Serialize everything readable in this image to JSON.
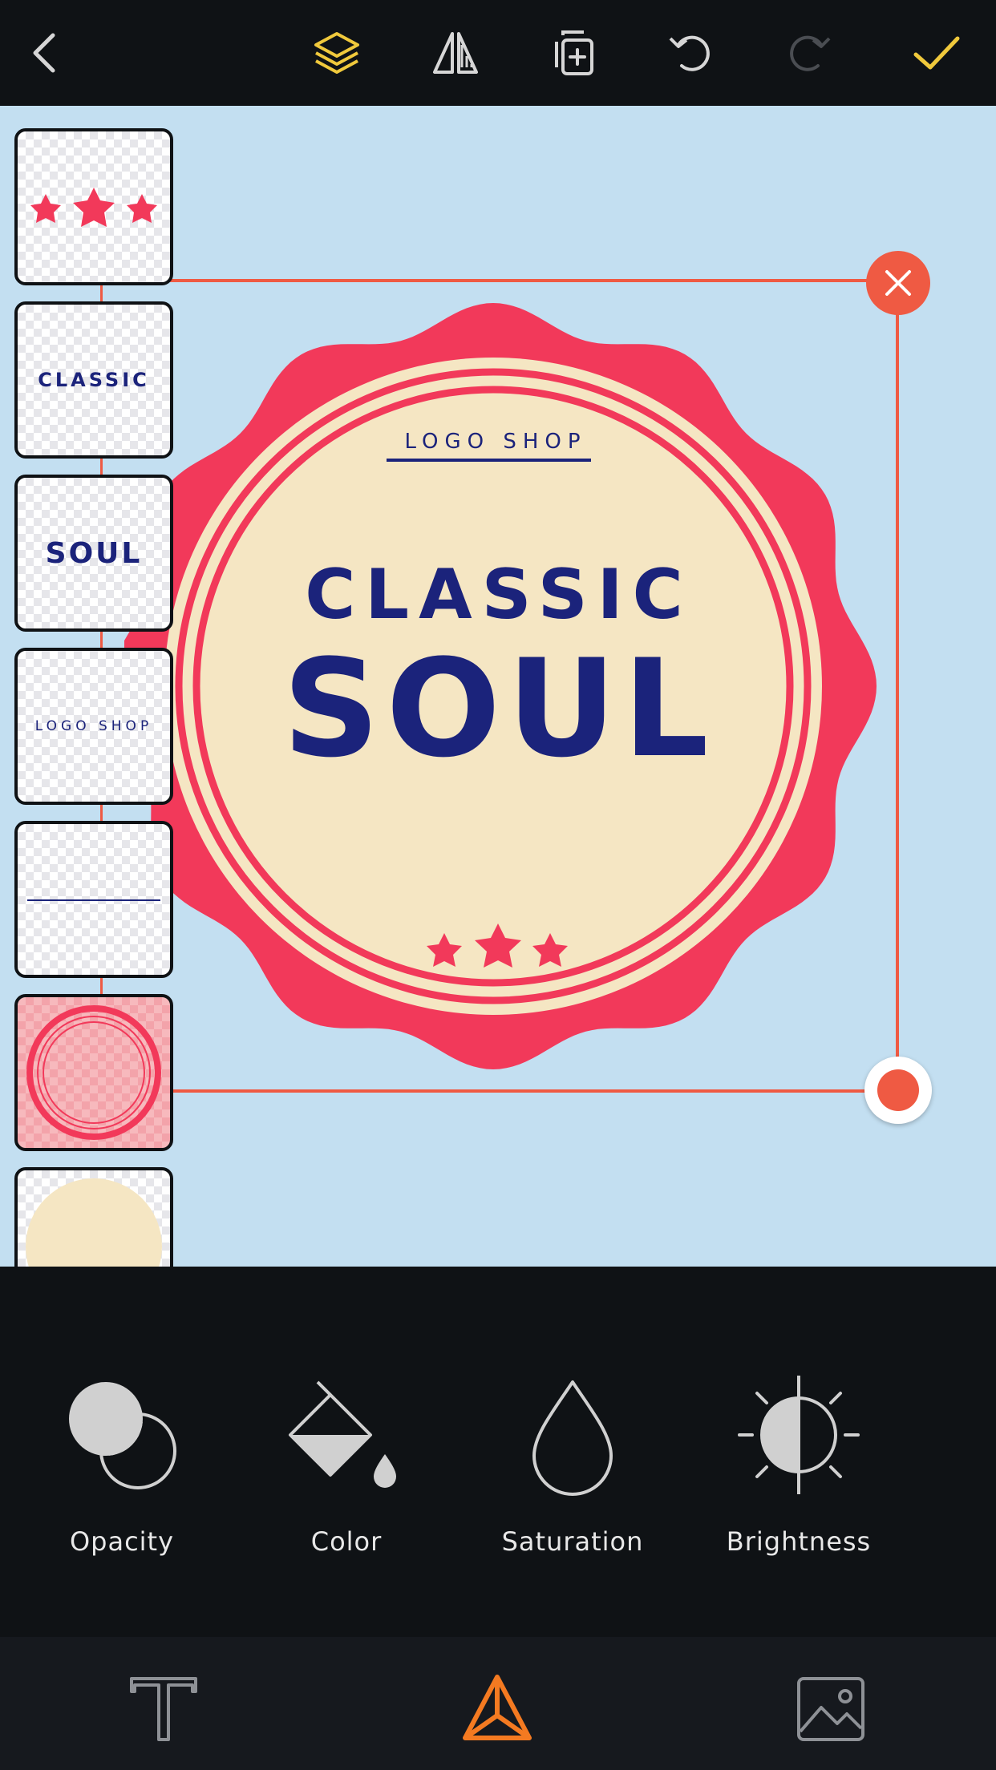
{
  "toolbar": {
    "back": "back-icon",
    "layers": "layers-icon",
    "flip": "flip-icon",
    "duplicate": "duplicate-icon",
    "undo": "undo-icon",
    "redo": "redo-icon",
    "done": "checkmark-icon"
  },
  "layers": [
    {
      "name": "stars-layer"
    },
    {
      "name": "classic-text-layer",
      "text": "CLASSIC"
    },
    {
      "name": "soul-text-layer",
      "text": "SOUL"
    },
    {
      "name": "logo-shop-text-layer",
      "text": "LOGO SHOP"
    },
    {
      "name": "line-layer"
    },
    {
      "name": "badge-frame-layer",
      "selected": true
    },
    {
      "name": "cream-circle-layer"
    }
  ],
  "badge": {
    "top_text": "LOGO SHOP",
    "line1": "CLASSIC",
    "line2": "SOUL"
  },
  "tools": [
    {
      "label": "Opacity",
      "icon": "opacity-icon"
    },
    {
      "label": "Color",
      "icon": "paint-bucket-icon"
    },
    {
      "label": "Saturation",
      "icon": "droplet-icon"
    },
    {
      "label": "Brightness",
      "icon": "brightness-icon"
    }
  ],
  "tabs": [
    {
      "icon": "text-icon"
    },
    {
      "icon": "shape-icon",
      "active": true
    },
    {
      "icon": "image-icon"
    }
  ],
  "colors": {
    "accent": "#ef5a43",
    "active_tool": "#f0c93c",
    "badge_red": "#f2395a",
    "badge_cream": "#f5e6c3",
    "badge_navy": "#1b237b",
    "canvas_bg": "#c3dff1",
    "tab_active": "#f47a21"
  }
}
